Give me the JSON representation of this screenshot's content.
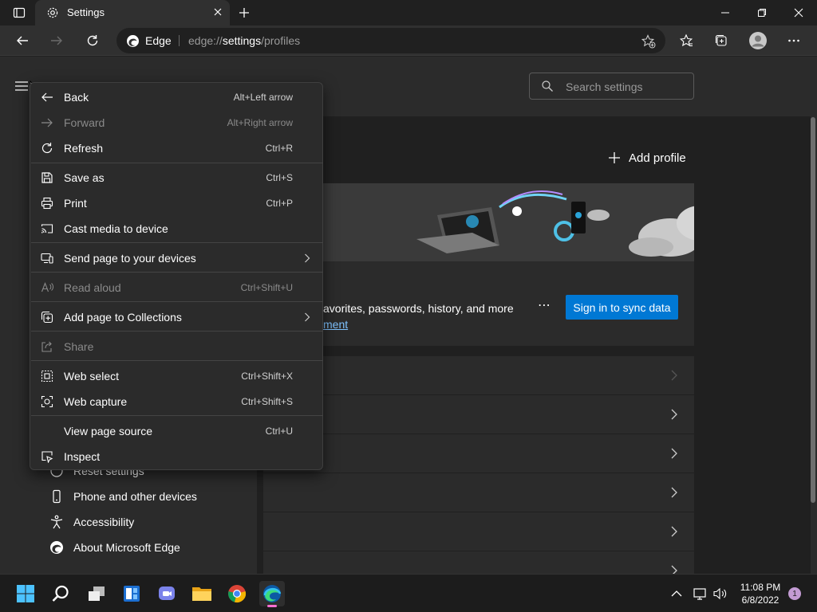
{
  "tab": {
    "title": "Settings"
  },
  "address": {
    "site_label": "Edge",
    "url_prefix": "edge://",
    "url_host": "settings",
    "url_path": "/profiles"
  },
  "search": {
    "placeholder": "Search settings"
  },
  "profiles": {
    "add_profile": "Add profile",
    "description": "avorites, passwords, history, and more",
    "link": "ment",
    "sign_in": "Sign in to sync data",
    "more": "⋯"
  },
  "sidebar": {
    "items": [
      {
        "label": "Reset settings",
        "icon": "reset-icon"
      },
      {
        "label": "Phone and other devices",
        "icon": "phone-icon"
      },
      {
        "label": "Accessibility",
        "icon": "accessibility-icon"
      },
      {
        "label": "About Microsoft Edge",
        "icon": "edge-logo-icon"
      }
    ]
  },
  "menu": {
    "items": [
      {
        "label": "Back",
        "shortcut": "Alt+Left arrow",
        "icon": "back-arrow-icon",
        "disabled": false
      },
      {
        "label": "Forward",
        "shortcut": "Alt+Right arrow",
        "icon": "forward-arrow-icon",
        "disabled": true
      },
      {
        "label": "Refresh",
        "shortcut": "Ctrl+R",
        "icon": "refresh-icon",
        "disabled": false
      },
      {
        "label": "Save as",
        "shortcut": "Ctrl+S",
        "icon": "save-icon",
        "disabled": false
      },
      {
        "label": "Print",
        "shortcut": "Ctrl+P",
        "icon": "print-icon",
        "disabled": false
      },
      {
        "label": "Cast media to device",
        "shortcut": "",
        "icon": "cast-icon",
        "disabled": false
      },
      {
        "label": "Send page to your devices",
        "shortcut": "",
        "icon": "send-devices-icon",
        "disabled": false,
        "submenu": true
      },
      {
        "label": "Read aloud",
        "shortcut": "Ctrl+Shift+U",
        "icon": "read-aloud-icon",
        "disabled": true
      },
      {
        "label": "Add page to Collections",
        "shortcut": "",
        "icon": "collections-icon",
        "disabled": false,
        "submenu": true
      },
      {
        "label": "Share",
        "shortcut": "",
        "icon": "share-icon",
        "disabled": true
      },
      {
        "label": "Web select",
        "shortcut": "Ctrl+Shift+X",
        "icon": "web-select-icon",
        "disabled": false
      },
      {
        "label": "Web capture",
        "shortcut": "Ctrl+Shift+S",
        "icon": "web-capture-icon",
        "disabled": false
      },
      {
        "label": "View page source",
        "shortcut": "Ctrl+U",
        "icon": "",
        "disabled": false
      },
      {
        "label": "Inspect",
        "shortcut": "",
        "icon": "inspect-icon",
        "disabled": false
      }
    ]
  },
  "taskbar": {
    "time": "11:08 PM",
    "date": "6/8/2022",
    "notifications": "1"
  },
  "colors": {
    "accent": "#0078d4",
    "link": "#7fc3ff",
    "menu_bg": "#2b2b2b"
  }
}
